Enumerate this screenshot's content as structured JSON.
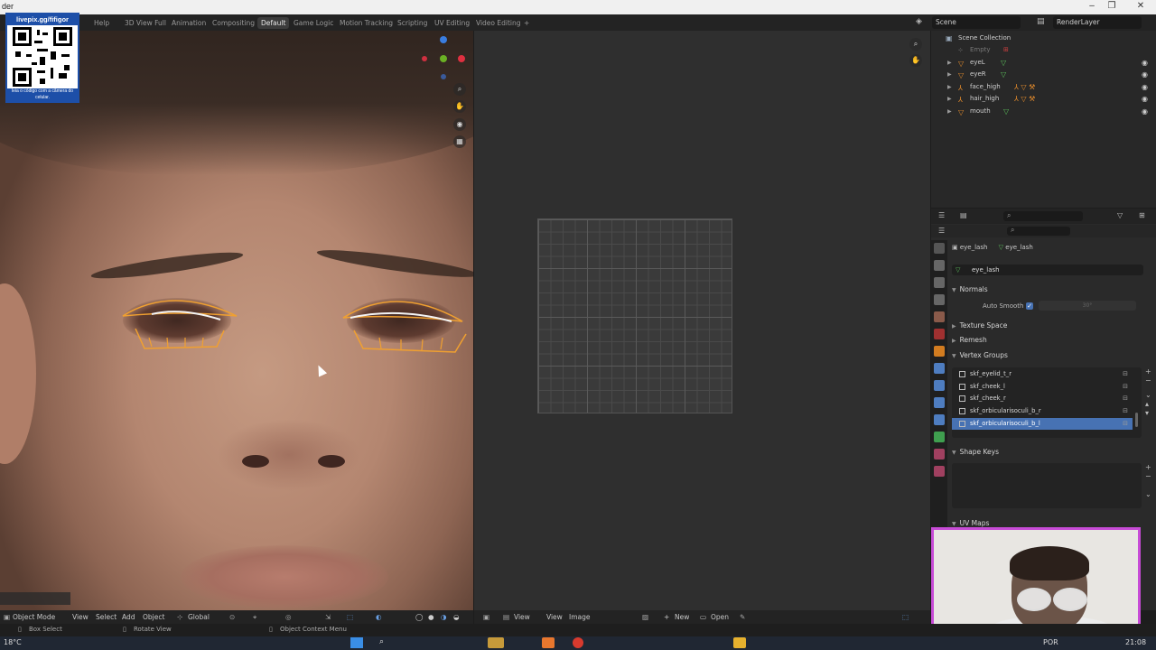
{
  "titlebar": {
    "title": "der"
  },
  "topbar": {
    "tabs": [
      {
        "label": "Help"
      },
      {
        "label": "3D View Full"
      },
      {
        "label": "Animation"
      },
      {
        "label": "Compositing"
      },
      {
        "label": "Default",
        "active": true
      },
      {
        "label": "Game Logic"
      },
      {
        "label": "Motion Tracking"
      },
      {
        "label": "Scripting"
      },
      {
        "label": "UV Editing"
      },
      {
        "label": "Video Editing"
      },
      {
        "label": "+"
      }
    ],
    "scene": "Scene",
    "render_layer": "RenderLayer"
  },
  "overlay_qr": {
    "title": "livepix.gg/fifigor",
    "caption": "leia o código com a câmera do celular."
  },
  "outliner": {
    "root": "Scene Collection",
    "items": [
      {
        "label": "Empty"
      },
      {
        "label": "eyeL"
      },
      {
        "label": "eyeR"
      },
      {
        "label": "face_high"
      },
      {
        "label": "hair_high"
      },
      {
        "label": "mouth"
      }
    ]
  },
  "properties": {
    "breadcrumb_object": "eye_lash",
    "breadcrumb_data": "eye_lash",
    "mesh_name": "eye_lash",
    "sections": {
      "normals": "Normals",
      "auto_smooth": "Auto Smooth",
      "auto_smooth_angle": "30°",
      "texture_space": "Texture Space",
      "remesh": "Remesh",
      "vertex_groups": "Vertex Groups",
      "shape_keys": "Shape Keys",
      "uv_maps": "UV Maps"
    },
    "vertex_groups": [
      {
        "label": "skf_eyelid_t_r"
      },
      {
        "label": "skf_cheek_l"
      },
      {
        "label": "skf_cheek_r"
      },
      {
        "label": "skf_orbicularisoculi_b_r"
      },
      {
        "label": "skf_orbicularisoculi_b_l",
        "selected": true
      }
    ]
  },
  "viewport_header": {
    "mode": "Object Mode",
    "view": "View",
    "select": "Select",
    "add": "Add",
    "object": "Object",
    "orientation": "Global"
  },
  "image_header": {
    "view": "View",
    "view2": "View",
    "image": "Image",
    "new": "New",
    "open": "Open"
  },
  "statusbar": {
    "box_select": "Box Select",
    "rotate_view": "Rotate View",
    "context_menu": "Object Context Menu"
  },
  "taskbar": {
    "temperature": "18°C",
    "language": "POR",
    "time": "21:08"
  },
  "colors": {
    "accent": "#4772b3",
    "selection_outline": "#f0a030",
    "webcam_border": "#c74bd6"
  }
}
